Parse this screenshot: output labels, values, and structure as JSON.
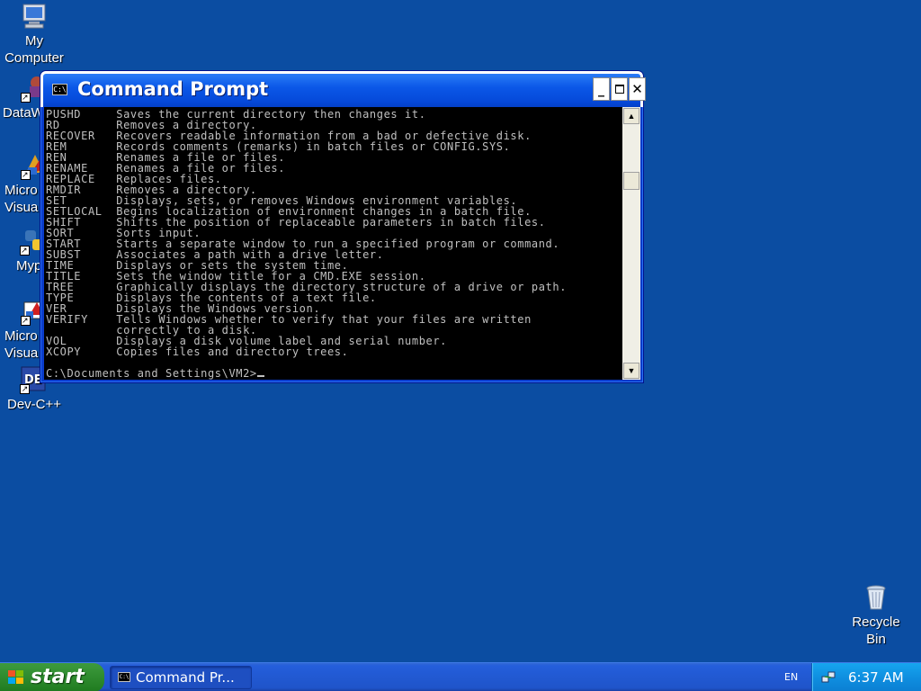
{
  "desktop": {
    "icons": [
      {
        "label_line1": "My",
        "label_line2": "Computer",
        "icon": "my-computer-icon"
      },
      {
        "label_line1": "DataW",
        "icon": "datawizard-icon"
      },
      {
        "label_line1": "Micro",
        "label_line2": "Visua",
        "icon": "visual-studio-icon"
      },
      {
        "label_line1": "Myp",
        "icon": "python-icon"
      },
      {
        "label_line1": "Micro",
        "label_line2": "Visua",
        "icon": "visual-studio-icon"
      },
      {
        "label_line1": "Dev-C++",
        "icon": "dev-cpp-icon"
      },
      {
        "label_line1": "Recycle",
        "label_line2": "Bin",
        "icon": "recycle-bin-icon"
      }
    ]
  },
  "window": {
    "title": "Command Prompt",
    "app_icon_text": "C:\\",
    "minimize_label": "_",
    "close_label": "✕"
  },
  "console": {
    "lines": [
      "PUSHD     Saves the current directory then changes it.",
      "RD        Removes a directory.",
      "RECOVER   Recovers readable information from a bad or defective disk.",
      "REM       Records comments (remarks) in batch files or CONFIG.SYS.",
      "REN       Renames a file or files.",
      "RENAME    Renames a file or files.",
      "REPLACE   Replaces files.",
      "RMDIR     Removes a directory.",
      "SET       Displays, sets, or removes Windows environment variables.",
      "SETLOCAL  Begins localization of environment changes in a batch file.",
      "SHIFT     Shifts the position of replaceable parameters in batch files.",
      "SORT      Sorts input.",
      "START     Starts a separate window to run a specified program or command.",
      "SUBST     Associates a path with a drive letter.",
      "TIME      Displays or sets the system time.",
      "TITLE     Sets the window title for a CMD.EXE session.",
      "TREE      Graphically displays the directory structure of a drive or path.",
      "TYPE      Displays the contents of a text file.",
      "VER       Displays the Windows version.",
      "VERIFY    Tells Windows whether to verify that your files are written",
      "          correctly to a disk.",
      "VOL       Displays a disk volume label and serial number.",
      "XCOPY     Copies files and directory trees.",
      "",
      "C:\\Documents and Settings\\VM2>"
    ]
  },
  "taskbar": {
    "start_label": "start",
    "task_label": "Command Pr...",
    "task_icon_text": "C:\\",
    "language": "EN",
    "clock": "6:37 AM"
  },
  "colors": {
    "desktop_bg": "#0b4da2",
    "console_text": "#c0c0c0",
    "console_bg": "#000000"
  }
}
